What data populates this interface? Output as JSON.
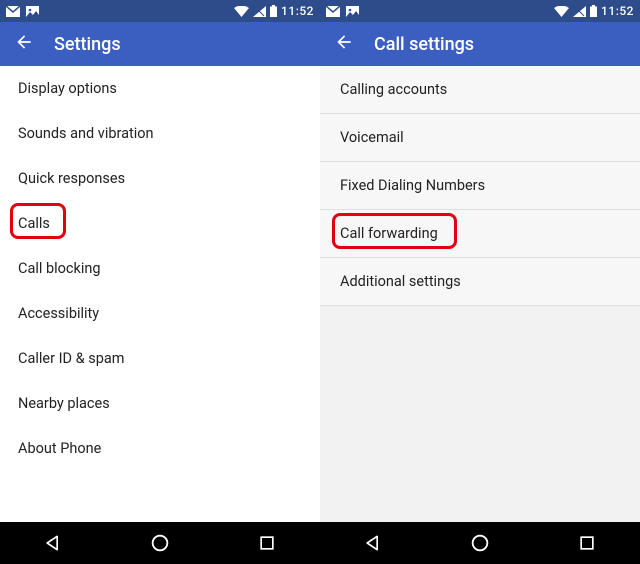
{
  "status": {
    "time": "11:52"
  },
  "left": {
    "title": "Settings",
    "items": [
      {
        "label": "Display options"
      },
      {
        "label": "Sounds and vibration"
      },
      {
        "label": "Quick responses"
      },
      {
        "label": "Calls",
        "highlighted": true
      },
      {
        "label": "Call blocking"
      },
      {
        "label": "Accessibility"
      },
      {
        "label": "Caller ID & spam"
      },
      {
        "label": "Nearby places"
      },
      {
        "label": "About Phone"
      }
    ]
  },
  "right": {
    "title": "Call settings",
    "items": [
      {
        "label": "Calling accounts"
      },
      {
        "label": "Voicemail"
      },
      {
        "label": "Fixed Dialing Numbers"
      },
      {
        "label": "Call forwarding",
        "highlighted": true
      },
      {
        "label": "Additional settings"
      }
    ]
  },
  "colors": {
    "statusbar": "#2e4b8a",
    "appbar": "#3b5fc1",
    "highlight": "#e3000f"
  },
  "icons": {
    "back": "arrow-left-icon",
    "gmail": "gmail-icon",
    "pictures": "pictures-icon",
    "wifi": "wifi-icon",
    "signal": "signal-icon",
    "battery": "battery-icon",
    "nav_back": "triangle-back-icon",
    "nav_home": "circle-home-icon",
    "nav_recent": "square-recent-icon"
  }
}
